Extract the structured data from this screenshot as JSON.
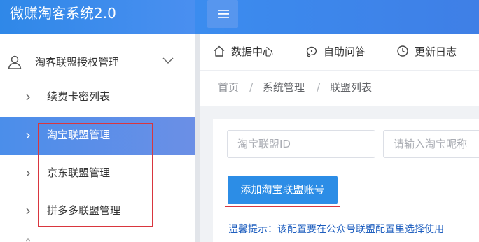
{
  "app": {
    "title": "微赚淘客系统2.0"
  },
  "sidebar": {
    "group": {
      "label": "淘客联盟授权管理",
      "icon": "user-icon",
      "expand_icon": "chevron-down-icon"
    },
    "items": [
      {
        "label": "续费卡密列表",
        "active": false
      },
      {
        "label": "淘宝联盟管理",
        "active": true
      },
      {
        "label": "京东联盟管理",
        "active": false
      },
      {
        "label": "拼多多联盟管理",
        "active": false
      }
    ]
  },
  "header": {
    "menu_icon": "hamburger-icon"
  },
  "quicknav": {
    "items": [
      {
        "label": "数据中心",
        "icon": "home-icon"
      },
      {
        "label": "自助问答",
        "icon": "help-icon"
      },
      {
        "label": "更新日志",
        "icon": "clock-icon"
      }
    ]
  },
  "breadcrumb": [
    "首页",
    "系统管理",
    "联盟列表"
  ],
  "breadcrumb_separator": "/",
  "search": {
    "alliance_id_placeholder": "淘宝联盟ID",
    "nickname_placeholder": "请输入淘宝昵称"
  },
  "actions": {
    "add_label": "添加淘宝联盟账号"
  },
  "tip": {
    "text": "温馨提示：该配置要在公众号联盟配置里选择使用"
  },
  "colors": {
    "primary": "#2c8de6",
    "header_gradient_start": "#2f88e8",
    "active_item": "#4b8eea",
    "highlight_border": "#d9363e",
    "tip_text": "#1f5fbf"
  }
}
